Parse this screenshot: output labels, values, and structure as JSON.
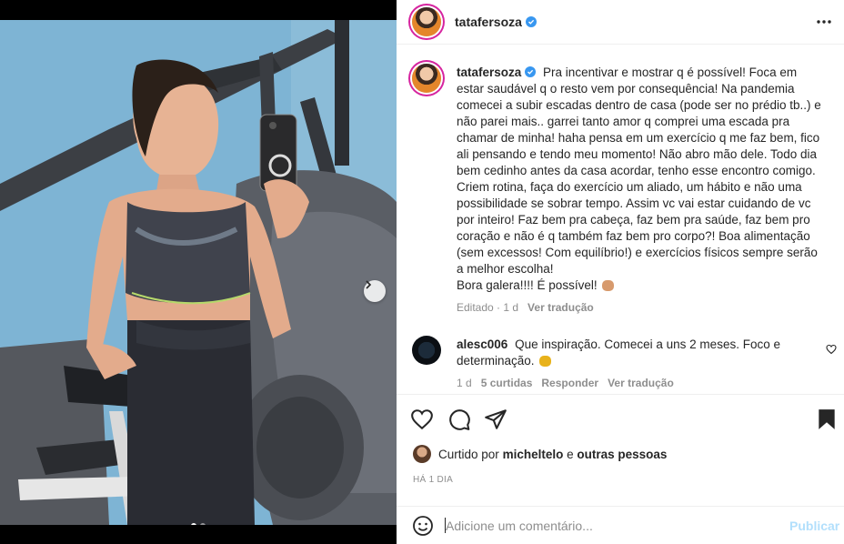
{
  "post": {
    "username": "tatafersoza",
    "verified": true,
    "caption": "Pra incentivar e mostrar q é possível! Foca em estar saudável q o resto vem por consequência! Na pandemia comecei a subir escadas dentro de casa (pode ser no prédio tb..) e não parei mais.. garrei tanto amor q comprei uma escada pra chamar de minha! haha pensa em um exercício q me faz bem, fico ali pensando e tendo meu momento! Não abro mão dele. Todo dia bem cedinho antes da casa acordar, tenho esse encontro comigo. Criem rotina, faça do exercício um aliado, um hábito e não uma possibilidade se sobrar tempo. Assim vc vai estar cuidando de vc por inteiro! Faz bem pra cabeça, faz bem pra saúde, faz bem pro coração e não é q também faz bem pro corpo?! Boa alimentação (sem excessos! Com equilíbrio!) e exercícios físicos sempre serão a melhor escolha!",
    "caption_end": "Bora galera!!!! É possível!",
    "caption_meta": "Editado · 1 d",
    "see_translation": "Ver tradução",
    "carousel_count": 2,
    "carousel_active": 1
  },
  "comment": {
    "username": "alesc006",
    "text": "Que inspiração. Comecei a uns 2 meses. Foco e determinação.",
    "age": "1 d",
    "likes": "5 curtidas",
    "reply": "Responder",
    "see_translation": "Ver tradução"
  },
  "likes": {
    "prefix": "Curtido por",
    "user": "micheltelo",
    "joiner": "e",
    "others": "outras pessoas"
  },
  "timestamp": "HÁ 1 DIA",
  "composer": {
    "placeholder": "Adicione um comentário...",
    "publish_label": "Publicar"
  },
  "colors": {
    "accent": "#0095f6",
    "publish_disabled": "#b2dffc",
    "muted": "#8e8e8e",
    "verified": "#3897f0"
  },
  "icons": [
    "heart-icon",
    "comment-icon",
    "share-icon",
    "bookmark-icon",
    "emoji-icon",
    "more-icon",
    "chevron-right-icon",
    "verified-icon"
  ]
}
